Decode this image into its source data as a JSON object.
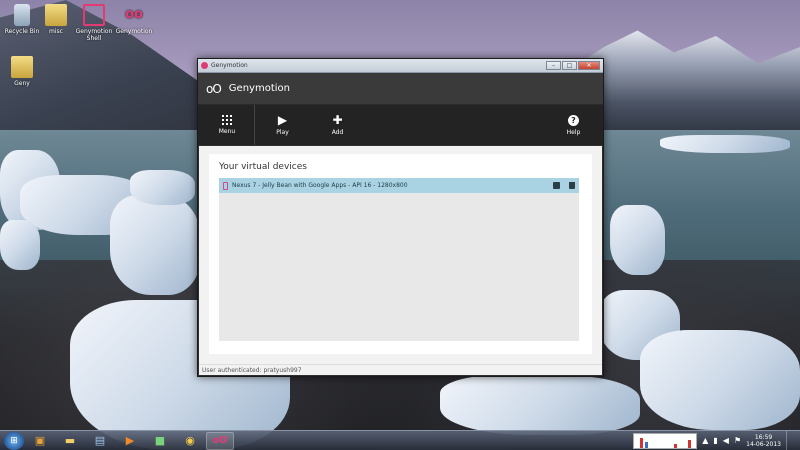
{
  "desktop": {
    "icons": [
      {
        "label": "Recycle Bin",
        "icon": "recycle-bin-icon"
      },
      {
        "label": "misc",
        "icon": "folder-icon"
      },
      {
        "label": "Genymotion Shell",
        "icon": "genymotion-shell-icon"
      },
      {
        "label": "Genymotion",
        "icon": "genymotion-icon"
      },
      {
        "label": "Geny",
        "icon": "folder-icon"
      }
    ]
  },
  "window": {
    "titlebar_text": "Genymotion",
    "controls": {
      "minimize": "–",
      "maximize": "□",
      "close": "✕"
    },
    "header_logo": "oO",
    "header_title": "Genymotion",
    "toolbar": {
      "menu_label": "Menu",
      "play_label": "Play",
      "add_label": "Add",
      "help_label": "Help"
    },
    "section_title": "Your virtual devices",
    "devices": [
      {
        "name": "Nexus 7 - Jelly Bean with Google Apps - API 16 - 1280x800"
      }
    ],
    "status": "User authenticated: pratyush997"
  },
  "taskbar": {
    "clock_time": "16:59",
    "clock_date": "14-06-2013"
  },
  "colors": {
    "genymotion_accent": "#e23b74",
    "selected_row": "#a9d3e2",
    "window_dark": "#232323"
  }
}
